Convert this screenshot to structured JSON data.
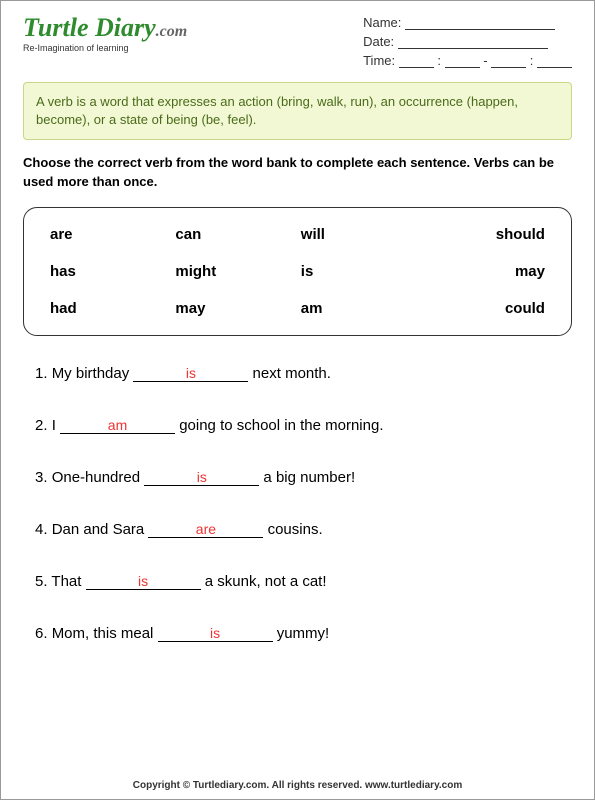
{
  "logo": {
    "main": "T",
    "rest": "urtle Diary",
    "ext": ".com",
    "tagline": "Re-Imagination of learning"
  },
  "meta": {
    "name": "Name:",
    "date": "Date:",
    "time": "Time:"
  },
  "definition": "A verb is a word that expresses an action (bring, walk, run), an occurrence (happen, become), or a state of being (be, feel).",
  "instruction": "Choose the correct verb from the word bank to complete each sentence. Verbs can be used more than once.",
  "wordbank": [
    [
      "are",
      "can",
      "will",
      "should"
    ],
    [
      "has",
      "might",
      "is",
      "may"
    ],
    [
      "had",
      "may",
      "am",
      "could"
    ]
  ],
  "sentences": [
    {
      "n": "1.",
      "pre": "My birthday ",
      "ans": "is",
      "post": " next month."
    },
    {
      "n": "2.",
      "pre": "I ",
      "ans": "am",
      "post": " going to school in the morning."
    },
    {
      "n": "3.",
      "pre": "One-hundred ",
      "ans": "is",
      "post": " a big number!"
    },
    {
      "n": "4.",
      "pre": "Dan and Sara ",
      "ans": "are",
      "post": " cousins."
    },
    {
      "n": "5.",
      "pre": "That ",
      "ans": "is",
      "post": " a skunk, not a cat!"
    },
    {
      "n": "6.",
      "pre": "Mom, this meal ",
      "ans": "is",
      "post": " yummy!"
    }
  ],
  "footer": "Copyright © Turtlediary.com. All rights reserved. www.turtlediary.com"
}
